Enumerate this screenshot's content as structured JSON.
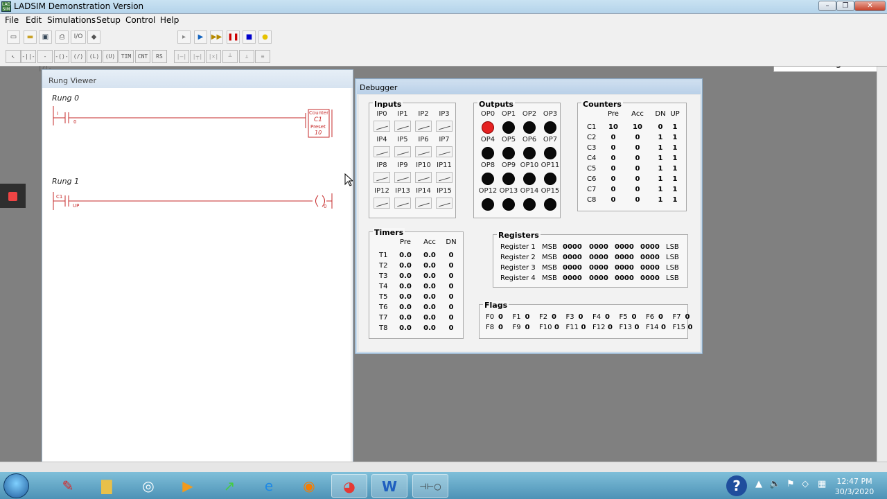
{
  "window": {
    "title": "LADSIM Demonstration Version",
    "app_icon_text": "LAD SIM"
  },
  "menu": [
    "File",
    "Edit",
    "Simulations",
    "Setup",
    "Control",
    "Help"
  ],
  "status": "Running...",
  "toolbar2_labels": {
    "tim": "TIM",
    "cnt": "CNT",
    "rs": "RS"
  },
  "io_label": "I/O",
  "rung_viewer": {
    "title": "Rung Viewer",
    "rungs": [
      {
        "label": "Rung 0",
        "contact_top": "I",
        "contact_sub": "0",
        "coil_title": "Counter",
        "coil_name": "C1",
        "coil_preset_label": "Preset",
        "coil_preset_value": "10"
      },
      {
        "label": "Rung 1",
        "contact_top": "C1",
        "contact_sub": "UP",
        "coil_glyph": "( )",
        "coil_sub": "0"
      }
    ]
  },
  "debugger": {
    "title": "Debugger",
    "inputs_title": "Inputs",
    "inputs": [
      "IP0",
      "IP1",
      "IP2",
      "IP3",
      "IP4",
      "IP5",
      "IP6",
      "IP7",
      "IP8",
      "IP9",
      "IP10",
      "IP11",
      "IP12",
      "IP13",
      "IP14",
      "IP15"
    ],
    "outputs_title": "Outputs",
    "outputs": [
      "OP0",
      "OP1",
      "OP2",
      "OP3",
      "OP4",
      "OP5",
      "OP6",
      "OP7",
      "OP8",
      "OP9",
      "OP10",
      "OP11",
      "OP12",
      "OP13",
      "OP14",
      "OP15"
    ],
    "output_states": [
      true,
      false,
      false,
      false,
      false,
      false,
      false,
      false,
      false,
      false,
      false,
      false,
      false,
      false,
      false,
      false
    ],
    "counters": {
      "title": "Counters",
      "headers": [
        "Pre",
        "Acc",
        "DN",
        "UP"
      ],
      "rows": [
        [
          "C1",
          "10",
          "10",
          "0",
          "1"
        ],
        [
          "C2",
          "0",
          "0",
          "1",
          "1"
        ],
        [
          "C3",
          "0",
          "0",
          "1",
          "1"
        ],
        [
          "C4",
          "0",
          "0",
          "1",
          "1"
        ],
        [
          "C5",
          "0",
          "0",
          "1",
          "1"
        ],
        [
          "C6",
          "0",
          "0",
          "1",
          "1"
        ],
        [
          "C7",
          "0",
          "0",
          "1",
          "1"
        ],
        [
          "C8",
          "0",
          "0",
          "1",
          "1"
        ]
      ]
    },
    "timers": {
      "title": "Timers",
      "headers": [
        "Pre",
        "Acc",
        "DN"
      ],
      "rows": [
        [
          "T1",
          "0.0",
          "0.0",
          "0"
        ],
        [
          "T2",
          "0.0",
          "0.0",
          "0"
        ],
        [
          "T3",
          "0.0",
          "0.0",
          "0"
        ],
        [
          "T4",
          "0.0",
          "0.0",
          "0"
        ],
        [
          "T5",
          "0.0",
          "0.0",
          "0"
        ],
        [
          "T6",
          "0.0",
          "0.0",
          "0"
        ],
        [
          "T7",
          "0.0",
          "0.0",
          "0"
        ],
        [
          "T8",
          "0.0",
          "0.0",
          "0"
        ]
      ]
    },
    "registers": {
      "title": "Registers",
      "rows": [
        [
          "Register 1",
          "MSB",
          "0000",
          "0000",
          "0000",
          "0000",
          "LSB"
        ],
        [
          "Register 2",
          "MSB",
          "0000",
          "0000",
          "0000",
          "0000",
          "LSB"
        ],
        [
          "Register 3",
          "MSB",
          "0000",
          "0000",
          "0000",
          "0000",
          "LSB"
        ],
        [
          "Register 4",
          "MSB",
          "0000",
          "0000",
          "0000",
          "0000",
          "LSB"
        ]
      ]
    },
    "flags": {
      "title": "Flags",
      "row1": [
        [
          "F0",
          "0"
        ],
        [
          "F1",
          "0"
        ],
        [
          "F2",
          "0"
        ],
        [
          "F3",
          "0"
        ],
        [
          "F4",
          "0"
        ],
        [
          "F5",
          "0"
        ],
        [
          "F6",
          "0"
        ],
        [
          "F7",
          "0"
        ]
      ],
      "row2": [
        [
          "F8",
          "0"
        ],
        [
          "F9",
          "0"
        ],
        [
          "F10",
          "0"
        ],
        [
          "F11",
          "0"
        ],
        [
          "F12",
          "0"
        ],
        [
          "F13",
          "0"
        ],
        [
          "F14",
          "0"
        ],
        [
          "F15",
          "0"
        ]
      ]
    }
  },
  "taskbar": {
    "time": "12:47 PM",
    "date": "30/3/2020",
    "apps": [
      "start-orb",
      "acrobat",
      "explorer",
      "network",
      "media",
      "project",
      "ie",
      "firefox",
      "chrome",
      "word",
      "ladsim"
    ]
  },
  "colors": {
    "ladder_red": "#c62828",
    "led_on": "#e52222",
    "led_off": "#0a0a0a",
    "taskbar": "#4d92b6"
  }
}
